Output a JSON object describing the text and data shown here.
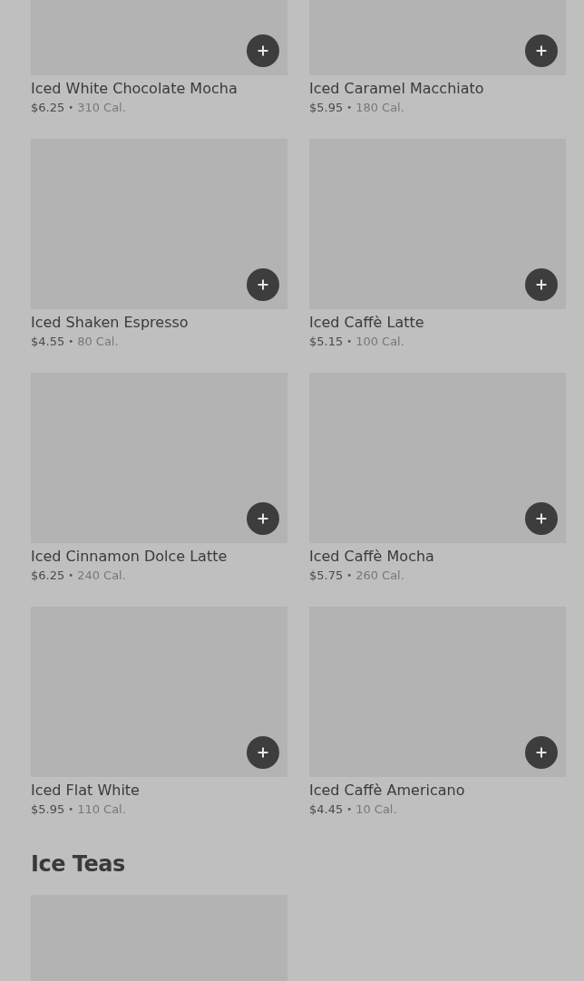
{
  "sections": [
    {
      "items": [
        {
          "kind": "product",
          "name": "Iced White Chocolate Mocha",
          "price": "$6.25",
          "separator": "•",
          "calories": "310 Cal."
        },
        {
          "kind": "product",
          "name": "Iced Caramel Macchiato",
          "price": "$5.95",
          "separator": "•",
          "calories": "180 Cal."
        },
        {
          "kind": "product",
          "name": "Iced Shaken Espresso",
          "price": "$4.55",
          "separator": "•",
          "calories": "80 Cal."
        },
        {
          "kind": "product",
          "name": "Iced Caffè Latte",
          "price": "$5.15",
          "separator": "•",
          "calories": "100 Cal."
        },
        {
          "kind": "product",
          "name": "Iced Cinnamon Dolce Latte",
          "price": "$6.25",
          "separator": "•",
          "calories": "240 Cal."
        },
        {
          "kind": "product",
          "name": "Iced Caffè Mocha",
          "price": "$5.75",
          "separator": "•",
          "calories": "260 Cal."
        },
        {
          "kind": "product",
          "name": "Iced Flat White",
          "price": "$5.95",
          "separator": "•",
          "calories": "110 Cal."
        },
        {
          "kind": "product",
          "name": "Iced Caffè Americano",
          "price": "$4.45",
          "separator": "•",
          "calories": "10 Cal."
        }
      ]
    },
    {
      "title": "Ice Teas",
      "items": [
        {
          "kind": "image"
        }
      ]
    }
  ]
}
